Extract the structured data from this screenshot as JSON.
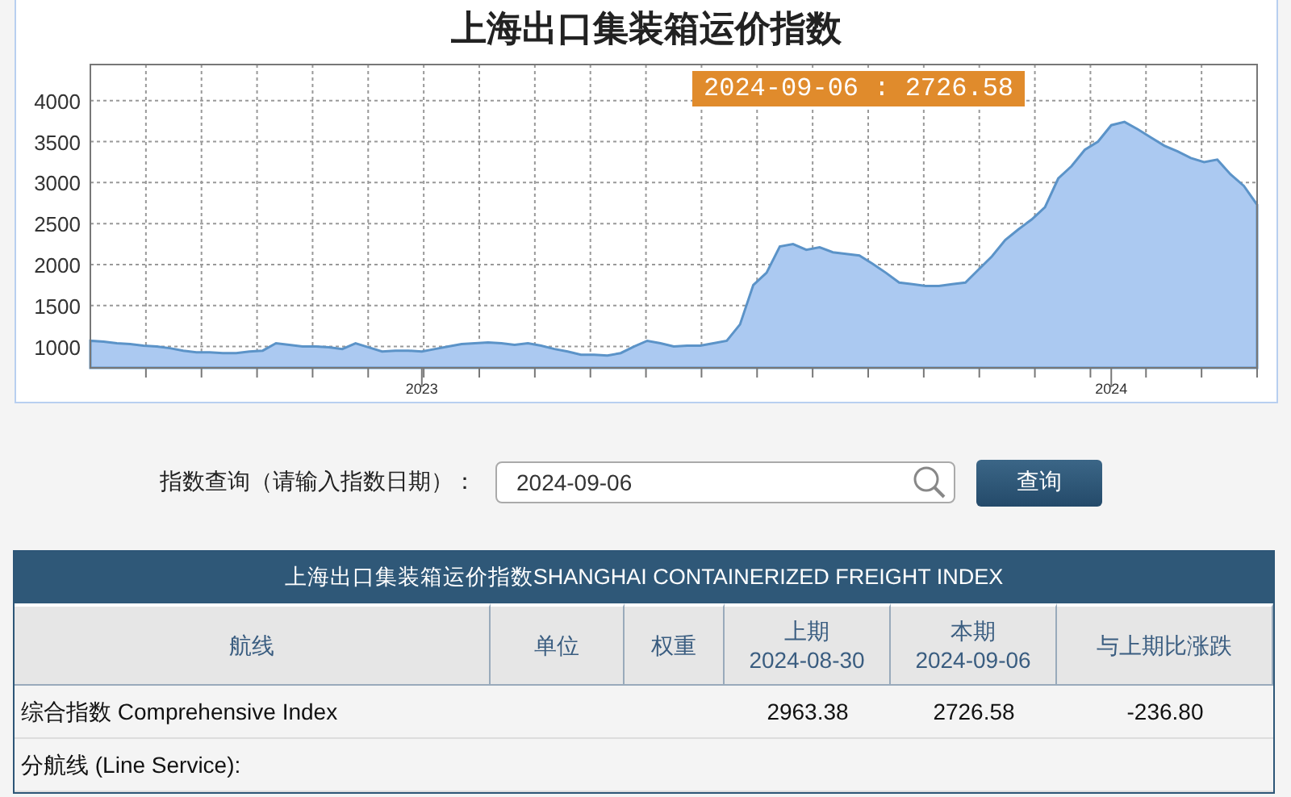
{
  "chart": {
    "title": "上海出口集装箱运价指数",
    "tooltip": "2024-09-06 : 2726.58",
    "chart_data": {
      "type": "area",
      "categories": [
        null,
        null,
        null,
        null,
        null,
        null,
        null,
        null,
        null,
        null,
        null,
        null,
        null,
        null,
        null,
        null,
        null,
        null,
        null,
        null,
        null,
        null,
        null,
        null,
        null,
        "2023",
        null,
        null,
        null,
        null,
        null,
        null,
        null,
        null,
        null,
        null,
        null,
        null,
        null,
        null,
        null,
        null,
        null,
        null,
        null,
        null,
        null,
        null,
        null,
        null,
        null,
        null,
        null,
        null,
        null,
        null,
        null,
        null,
        null,
        null,
        null,
        null,
        null,
        null,
        null,
        null,
        null,
        null,
        null,
        null,
        null,
        null,
        null,
        null,
        null,
        null,
        null,
        "2024",
        null,
        null,
        null,
        null,
        null,
        null,
        null,
        null,
        null,
        null,
        null
      ],
      "series": [
        {
          "color": "#5b93c8",
          "values": [
            1070,
            1060,
            1040,
            1030,
            1010,
            1000,
            980,
            950,
            930,
            930,
            920,
            920,
            940,
            950,
            1040,
            1020,
            1000,
            1000,
            990,
            970,
            1040,
            990,
            940,
            950,
            950,
            940,
            970,
            1000,
            1030,
            1040,
            1050,
            1040,
            1020,
            1040,
            1010,
            970,
            940,
            900,
            900,
            890,
            920,
            1000,
            1070,
            1040,
            1000,
            1010,
            1010,
            1040,
            1070,
            1270,
            1750,
            1900,
            2220,
            2250,
            2180,
            2210,
            2150,
            2130,
            2110,
            2010,
            1900,
            1780,
            1760,
            1740,
            1740,
            1760,
            1780,
            1940,
            2100,
            2300,
            2430,
            2550,
            2700,
            3050,
            3200,
            3400,
            3500,
            3700,
            3740,
            3650,
            3550,
            3450,
            3380,
            3300,
            3250,
            3280,
            3100,
            2960,
            2730
          ]
        }
      ],
      "grid": true,
      "ylim": [
        740,
        4440
      ],
      "yticks": [
        1000,
        1500,
        2000,
        2500,
        3000,
        3500,
        4000
      ]
    }
  },
  "search": {
    "label": "指数查询（请输入指数日期）：",
    "value": "2024-09-06",
    "button": "查询"
  },
  "table": {
    "title": "上海出口集装箱运价指数SHANGHAI CONTAINERIZED FREIGHT INDEX",
    "columns": [
      {
        "label": "航线"
      },
      {
        "label": "单位"
      },
      {
        "label": "权重"
      },
      {
        "label": "上期",
        "date": "2024-08-30"
      },
      {
        "label": "本期",
        "date": "2024-09-06"
      },
      {
        "label": "与上期比涨跌"
      }
    ],
    "rows": [
      {
        "kind": "index",
        "route": "综合指数 Comprehensive Index",
        "previous": "2963.38",
        "current": "2726.58",
        "change": "-236.80"
      },
      {
        "kind": "section",
        "route": "分航线 (Line Service):"
      }
    ]
  }
}
